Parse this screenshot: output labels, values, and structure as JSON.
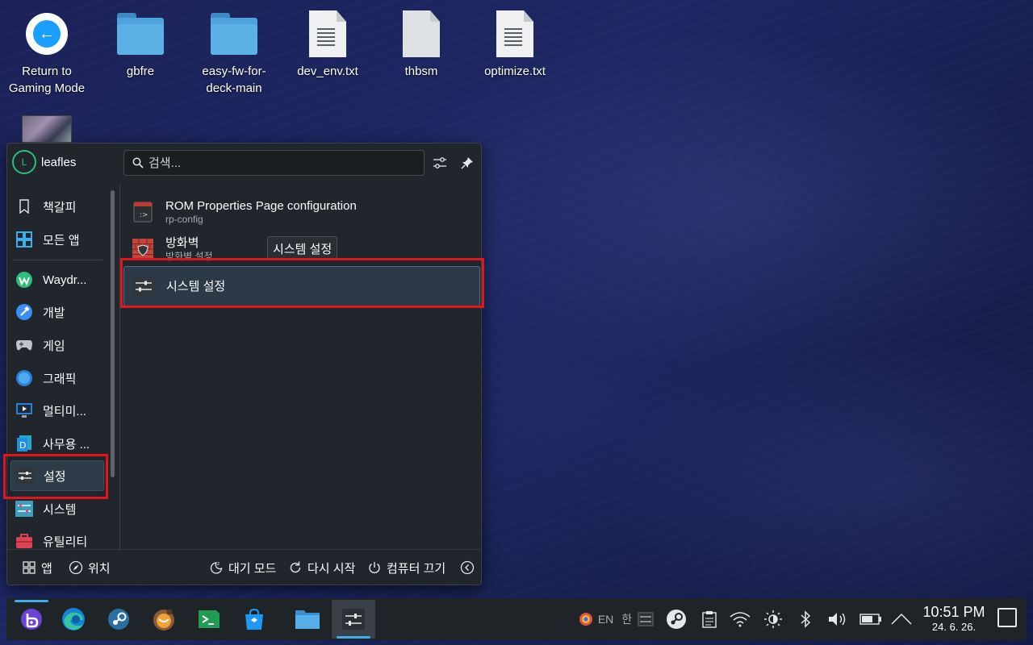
{
  "desktop": {
    "icons": [
      {
        "label": "Return to\nGaming Mode",
        "icon": "steam-return-icon"
      },
      {
        "label": "gbfre",
        "icon": "folder-icon"
      },
      {
        "label": "easy-fw-for-\ndeck-main",
        "icon": "folder-icon"
      },
      {
        "label": "dev_env.txt",
        "icon": "text-file-icon"
      },
      {
        "label": "thbsm",
        "icon": "file-icon"
      },
      {
        "label": "optimize.txt",
        "icon": "text-file-icon"
      }
    ]
  },
  "launcher": {
    "username": "leafles",
    "avatar_letter": "L",
    "search_placeholder": "검색...",
    "categories": [
      {
        "label": "책갈피",
        "icon": "bookmark-icon"
      },
      {
        "label": "모든 앱",
        "icon": "all-apps-icon"
      },
      {
        "label": "Waydr...",
        "icon": "waydroid-icon"
      },
      {
        "label": "개발",
        "icon": "development-icon"
      },
      {
        "label": "게임",
        "icon": "gamepad-icon"
      },
      {
        "label": "그래픽",
        "icon": "graphics-icon"
      },
      {
        "label": "멀티미...",
        "icon": "multimedia-icon"
      },
      {
        "label": "사무용 ...",
        "icon": "office-icon"
      },
      {
        "label": "설정",
        "icon": "settings-icon"
      },
      {
        "label": "시스템",
        "icon": "system-icon"
      },
      {
        "label": "유틸리티",
        "icon": "utilities-icon"
      }
    ],
    "selected_category": "설정",
    "results": [
      {
        "title": "ROM Properties Page configuration",
        "subtitle": "rp-config",
        "icon": "rom-properties-icon"
      },
      {
        "title": "방화벽",
        "subtitle": "방화벽 설정",
        "icon": "firewall-icon"
      },
      {
        "title": "시스템 설정",
        "subtitle": "",
        "icon": "system-settings-icon"
      }
    ],
    "tooltip": "시스템 설정",
    "footer": {
      "apps": "앱",
      "places": "위치",
      "sleep": "대기 모드",
      "restart": "다시 시작",
      "shutdown": "컴퓨터 끄기"
    }
  },
  "taskbar": {
    "apps": [
      {
        "name": "application-launcher-icon"
      },
      {
        "name": "edge-browser-icon"
      },
      {
        "name": "steam-icon"
      },
      {
        "name": "bottles-icon"
      },
      {
        "name": "konsole-icon"
      },
      {
        "name": "discover-store-icon"
      },
      {
        "name": "dolphin-files-icon"
      },
      {
        "name": "system-settings-icon"
      }
    ],
    "tray": {
      "lang": "EN",
      "input_mode": "한"
    },
    "clock": {
      "time": "10:51 PM",
      "date": "24. 6. 26."
    }
  },
  "colors": {
    "accent": "#3daee9",
    "highlight_box": "#e0161b",
    "panel_bg": "#20262c"
  }
}
